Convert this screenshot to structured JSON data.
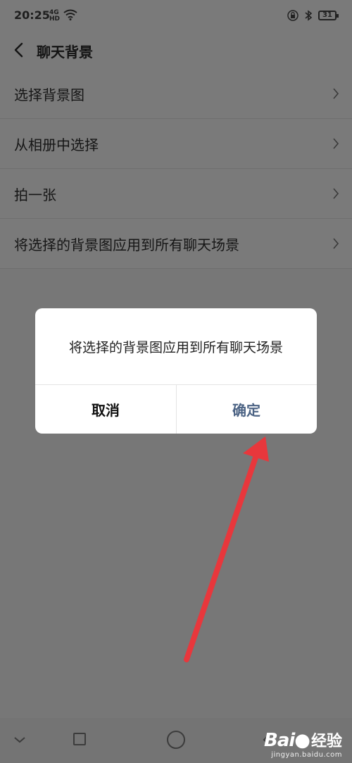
{
  "status_bar": {
    "time": "20:25",
    "signal": "4G",
    "signal_sub": "HD",
    "battery": "31"
  },
  "header": {
    "title": "聊天背景"
  },
  "menu": {
    "items": [
      {
        "label": "选择背景图"
      },
      {
        "label": "从相册中选择"
      },
      {
        "label": "拍一张"
      },
      {
        "label": "将选择的背景图应用到所有聊天场景"
      }
    ]
  },
  "dialog": {
    "message": "将选择的背景图应用到所有聊天场景",
    "cancel_label": "取消",
    "confirm_label": "确定"
  },
  "watermark": {
    "logo": "Bai",
    "logo_suffix": "经验",
    "url": "jingyan.baidu.com"
  },
  "colors": {
    "overlay_background": "#777777",
    "confirm_text": "#4d6485",
    "arrow": "#e8373c"
  }
}
